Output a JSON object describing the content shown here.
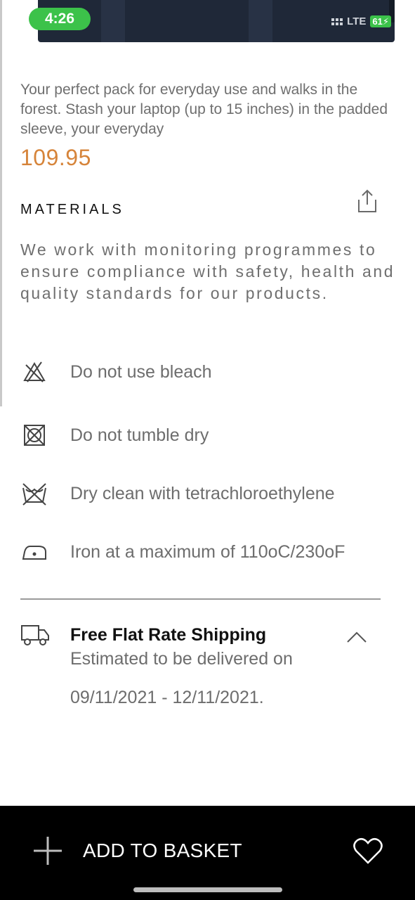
{
  "status_bar": {
    "time": "4:26",
    "network": "LTE",
    "battery": "61"
  },
  "product": {
    "description": "Your perfect pack for everyday use and walks in the forest. Stash your laptop (up to 15 inches) in the padded sleeve, your everyday",
    "price": "109.95",
    "price_color": "#d6843a"
  },
  "materials": {
    "title": "MATERIALS",
    "text": "We work with monitoring programmes to ensure compliance with safety, health and quality standards for our products.",
    "share_icon": "share-icon"
  },
  "care": [
    {
      "icon": "no-bleach-icon",
      "label": "Do not use bleach"
    },
    {
      "icon": "no-tumble-dry-icon",
      "label": "Do not tumble dry"
    },
    {
      "icon": "dry-clean-icon",
      "label": "Dry clean with tetrachloroethylene"
    },
    {
      "icon": "iron-icon",
      "label": "Iron at a maximum of 110oC/230oF"
    }
  ],
  "shipping": {
    "icon": "truck-icon",
    "title": "Free Flat Rate Shipping",
    "subtitle": "Estimated to be delivered on",
    "dates": "09/11/2021 - 12/11/2021."
  },
  "bottom_bar": {
    "add_label": "ADD TO BASKET",
    "add_icon": "plus-icon",
    "wishlist_icon": "heart-icon"
  }
}
